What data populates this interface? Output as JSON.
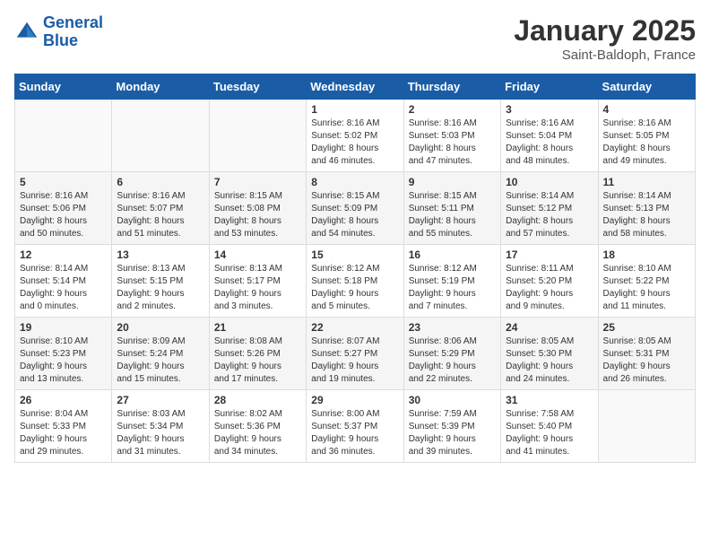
{
  "logo": {
    "line1": "General",
    "line2": "Blue"
  },
  "title": "January 2025",
  "location": "Saint-Baldoph, France",
  "weekdays": [
    "Sunday",
    "Monday",
    "Tuesday",
    "Wednesday",
    "Thursday",
    "Friday",
    "Saturday"
  ],
  "weeks": [
    [
      {
        "day": "",
        "info": ""
      },
      {
        "day": "",
        "info": ""
      },
      {
        "day": "",
        "info": ""
      },
      {
        "day": "1",
        "info": "Sunrise: 8:16 AM\nSunset: 5:02 PM\nDaylight: 8 hours\nand 46 minutes."
      },
      {
        "day": "2",
        "info": "Sunrise: 8:16 AM\nSunset: 5:03 PM\nDaylight: 8 hours\nand 47 minutes."
      },
      {
        "day": "3",
        "info": "Sunrise: 8:16 AM\nSunset: 5:04 PM\nDaylight: 8 hours\nand 48 minutes."
      },
      {
        "day": "4",
        "info": "Sunrise: 8:16 AM\nSunset: 5:05 PM\nDaylight: 8 hours\nand 49 minutes."
      }
    ],
    [
      {
        "day": "5",
        "info": "Sunrise: 8:16 AM\nSunset: 5:06 PM\nDaylight: 8 hours\nand 50 minutes."
      },
      {
        "day": "6",
        "info": "Sunrise: 8:16 AM\nSunset: 5:07 PM\nDaylight: 8 hours\nand 51 minutes."
      },
      {
        "day": "7",
        "info": "Sunrise: 8:15 AM\nSunset: 5:08 PM\nDaylight: 8 hours\nand 53 minutes."
      },
      {
        "day": "8",
        "info": "Sunrise: 8:15 AM\nSunset: 5:09 PM\nDaylight: 8 hours\nand 54 minutes."
      },
      {
        "day": "9",
        "info": "Sunrise: 8:15 AM\nSunset: 5:11 PM\nDaylight: 8 hours\nand 55 minutes."
      },
      {
        "day": "10",
        "info": "Sunrise: 8:14 AM\nSunset: 5:12 PM\nDaylight: 8 hours\nand 57 minutes."
      },
      {
        "day": "11",
        "info": "Sunrise: 8:14 AM\nSunset: 5:13 PM\nDaylight: 8 hours\nand 58 minutes."
      }
    ],
    [
      {
        "day": "12",
        "info": "Sunrise: 8:14 AM\nSunset: 5:14 PM\nDaylight: 9 hours\nand 0 minutes."
      },
      {
        "day": "13",
        "info": "Sunrise: 8:13 AM\nSunset: 5:15 PM\nDaylight: 9 hours\nand 2 minutes."
      },
      {
        "day": "14",
        "info": "Sunrise: 8:13 AM\nSunset: 5:17 PM\nDaylight: 9 hours\nand 3 minutes."
      },
      {
        "day": "15",
        "info": "Sunrise: 8:12 AM\nSunset: 5:18 PM\nDaylight: 9 hours\nand 5 minutes."
      },
      {
        "day": "16",
        "info": "Sunrise: 8:12 AM\nSunset: 5:19 PM\nDaylight: 9 hours\nand 7 minutes."
      },
      {
        "day": "17",
        "info": "Sunrise: 8:11 AM\nSunset: 5:20 PM\nDaylight: 9 hours\nand 9 minutes."
      },
      {
        "day": "18",
        "info": "Sunrise: 8:10 AM\nSunset: 5:22 PM\nDaylight: 9 hours\nand 11 minutes."
      }
    ],
    [
      {
        "day": "19",
        "info": "Sunrise: 8:10 AM\nSunset: 5:23 PM\nDaylight: 9 hours\nand 13 minutes."
      },
      {
        "day": "20",
        "info": "Sunrise: 8:09 AM\nSunset: 5:24 PM\nDaylight: 9 hours\nand 15 minutes."
      },
      {
        "day": "21",
        "info": "Sunrise: 8:08 AM\nSunset: 5:26 PM\nDaylight: 9 hours\nand 17 minutes."
      },
      {
        "day": "22",
        "info": "Sunrise: 8:07 AM\nSunset: 5:27 PM\nDaylight: 9 hours\nand 19 minutes."
      },
      {
        "day": "23",
        "info": "Sunrise: 8:06 AM\nSunset: 5:29 PM\nDaylight: 9 hours\nand 22 minutes."
      },
      {
        "day": "24",
        "info": "Sunrise: 8:05 AM\nSunset: 5:30 PM\nDaylight: 9 hours\nand 24 minutes."
      },
      {
        "day": "25",
        "info": "Sunrise: 8:05 AM\nSunset: 5:31 PM\nDaylight: 9 hours\nand 26 minutes."
      }
    ],
    [
      {
        "day": "26",
        "info": "Sunrise: 8:04 AM\nSunset: 5:33 PM\nDaylight: 9 hours\nand 29 minutes."
      },
      {
        "day": "27",
        "info": "Sunrise: 8:03 AM\nSunset: 5:34 PM\nDaylight: 9 hours\nand 31 minutes."
      },
      {
        "day": "28",
        "info": "Sunrise: 8:02 AM\nSunset: 5:36 PM\nDaylight: 9 hours\nand 34 minutes."
      },
      {
        "day": "29",
        "info": "Sunrise: 8:00 AM\nSunset: 5:37 PM\nDaylight: 9 hours\nand 36 minutes."
      },
      {
        "day": "30",
        "info": "Sunrise: 7:59 AM\nSunset: 5:39 PM\nDaylight: 9 hours\nand 39 minutes."
      },
      {
        "day": "31",
        "info": "Sunrise: 7:58 AM\nSunset: 5:40 PM\nDaylight: 9 hours\nand 41 minutes."
      },
      {
        "day": "",
        "info": ""
      }
    ]
  ]
}
